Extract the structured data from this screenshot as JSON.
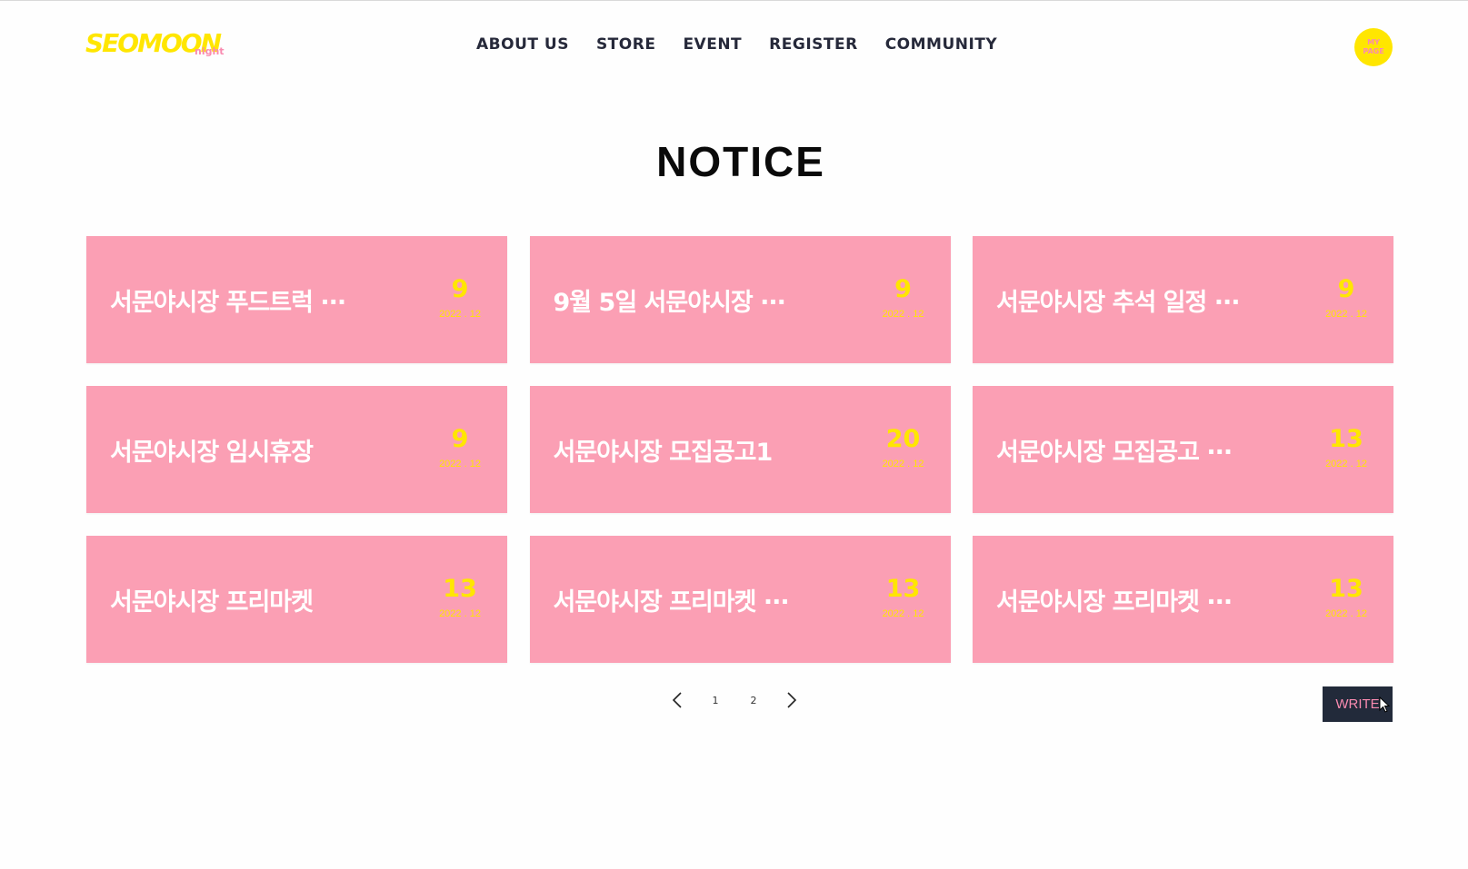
{
  "brand": {
    "logo_main": "SEOMOON",
    "logo_sub": "night",
    "primary_color": "#ffe600",
    "accent_color": "#fb9fb4",
    "dark_color": "#222a3a"
  },
  "nav": {
    "items": [
      "ABOUT US",
      "STORE",
      "EVENT",
      "REGISTER",
      "COMMUNITY"
    ]
  },
  "mypage": {
    "line1": "MY",
    "line2": "PAGE"
  },
  "page": {
    "title": "NOTICE"
  },
  "notices": [
    {
      "title": "서문야시장 푸드트럭 ···",
      "day": "9",
      "date": "2022 . 12"
    },
    {
      "title": "9월 5일 서문야시장 ···",
      "day": "9",
      "date": "2022 . 12"
    },
    {
      "title": "서문야시장 추석 일정 ···",
      "day": "9",
      "date": "2022 . 12"
    },
    {
      "title": "서문야시장 임시휴장",
      "day": "9",
      "date": "2022 . 12"
    },
    {
      "title": "서문야시장 모집공고1",
      "day": "20",
      "date": "2022 . 12"
    },
    {
      "title": "서문야시장 모집공고 ···",
      "day": "13",
      "date": "2022 . 12"
    },
    {
      "title": "서문야시장 프리마켓",
      "day": "13",
      "date": "2022 . 12"
    },
    {
      "title": "서문야시장 프리마켓 ···",
      "day": "13",
      "date": "2022 . 12"
    },
    {
      "title": "서문야시장 프리마켓 ···",
      "day": "13",
      "date": "2022 . 12"
    }
  ],
  "pagination": {
    "pages": [
      "1",
      "2"
    ]
  },
  "write_label": "WRITE"
}
